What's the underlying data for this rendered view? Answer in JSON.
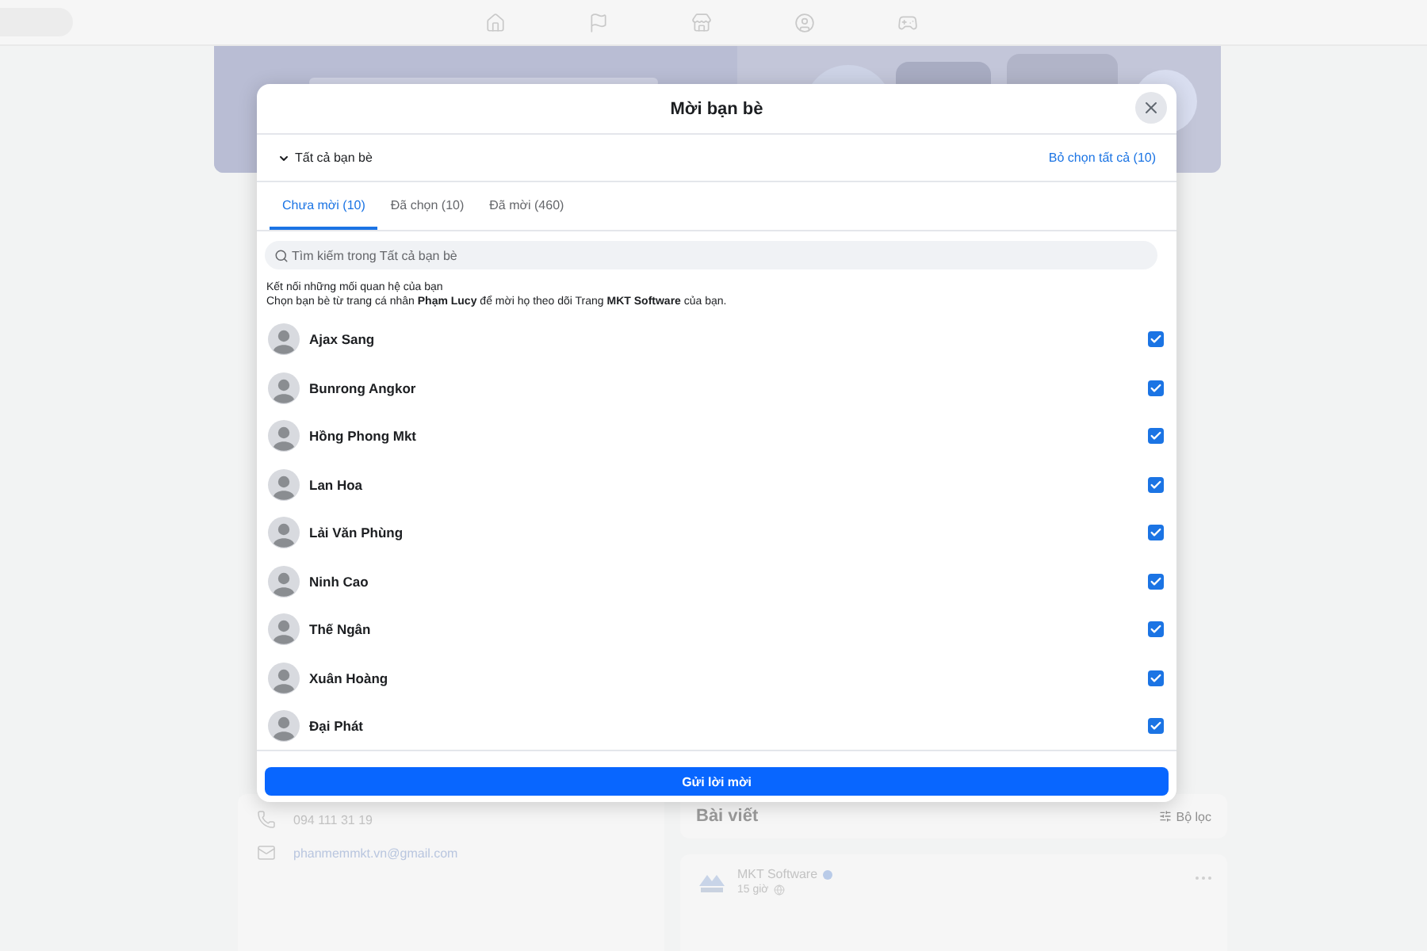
{
  "background": {
    "contact": {
      "phone": "094 111 31 19",
      "email": "phanmemmkt.vn@gmail.com"
    },
    "posts": {
      "title": "Bài viết",
      "filter": "Bộ lọc",
      "post": {
        "author": "MKT Software",
        "time": "15 giờ"
      }
    }
  },
  "dialog": {
    "title": "Mời bạn bè",
    "audience": "Tất cả bạn bè",
    "deselect_all": "Bỏ chọn tất cả (10)",
    "tabs": [
      {
        "label": "Chưa mời (10)",
        "selected": true
      },
      {
        "label": "Đã chọn (10)",
        "selected": false
      },
      {
        "label": "Đã mời (460)",
        "selected": false
      }
    ],
    "search": {
      "placeholder": "Tìm kiếm trong Tất cả bạn bè"
    },
    "intro": {
      "heading": "Kết nối những mối quan hệ của bạn",
      "text": "Chọn bạn bè từ trang cá nhân **Phạm Lucy** để mời họ theo dõi Trang **MKT Software** của bạn."
    },
    "friends": [
      {
        "name": "Ajax Sang",
        "checked": true
      },
      {
        "name": "Bunrong Angkor",
        "checked": true
      },
      {
        "name": "Hồng Phong Mkt",
        "checked": true
      },
      {
        "name": "Lan Hoa",
        "checked": true
      },
      {
        "name": "Lải Văn Phùng",
        "checked": true
      },
      {
        "name": "Ninh Cao",
        "checked": true
      },
      {
        "name": "Thế Ngân",
        "checked": true
      },
      {
        "name": "Xuân Hoàng",
        "checked": true
      },
      {
        "name": "Đại Phát",
        "checked": true
      }
    ],
    "submit": "Gửi lời mời"
  }
}
